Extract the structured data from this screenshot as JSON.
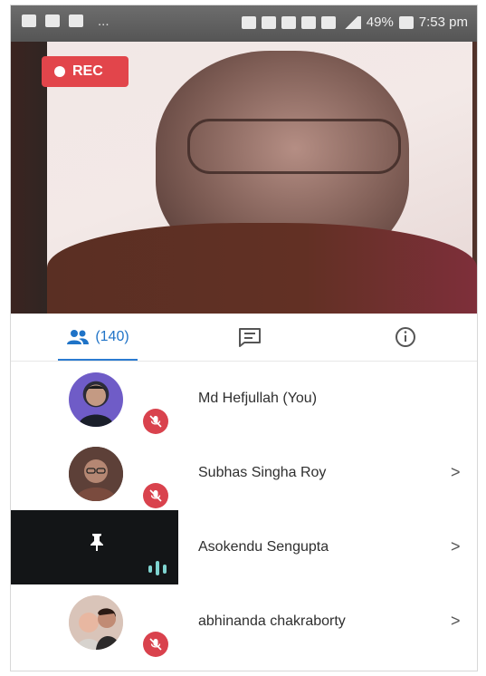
{
  "status_bar": {
    "battery": "49%",
    "time": "7:53 pm",
    "ellipsis": "..."
  },
  "video": {
    "recording_label": "REC"
  },
  "tabs": {
    "participants_count": "(140)",
    "active": "participants",
    "icons": [
      "people-icon",
      "chat-icon",
      "info-icon"
    ]
  },
  "participants": [
    {
      "name": "Md Hefjullah (You)",
      "muted": true,
      "chevron": ""
    },
    {
      "name": "Subhas Singha Roy",
      "muted": true,
      "chevron": ">"
    },
    {
      "name": "Asokendu Sengupta",
      "muted": false,
      "speaking": true,
      "pinned": true,
      "chevron": ">"
    },
    {
      "name": "abhinanda chakraborty",
      "muted": true,
      "chevron": ">"
    }
  ],
  "colors": {
    "accent": "#2b7bd1",
    "rec": "#e2454b",
    "mute": "#d9424d",
    "speaking": "#7fd4d0"
  }
}
